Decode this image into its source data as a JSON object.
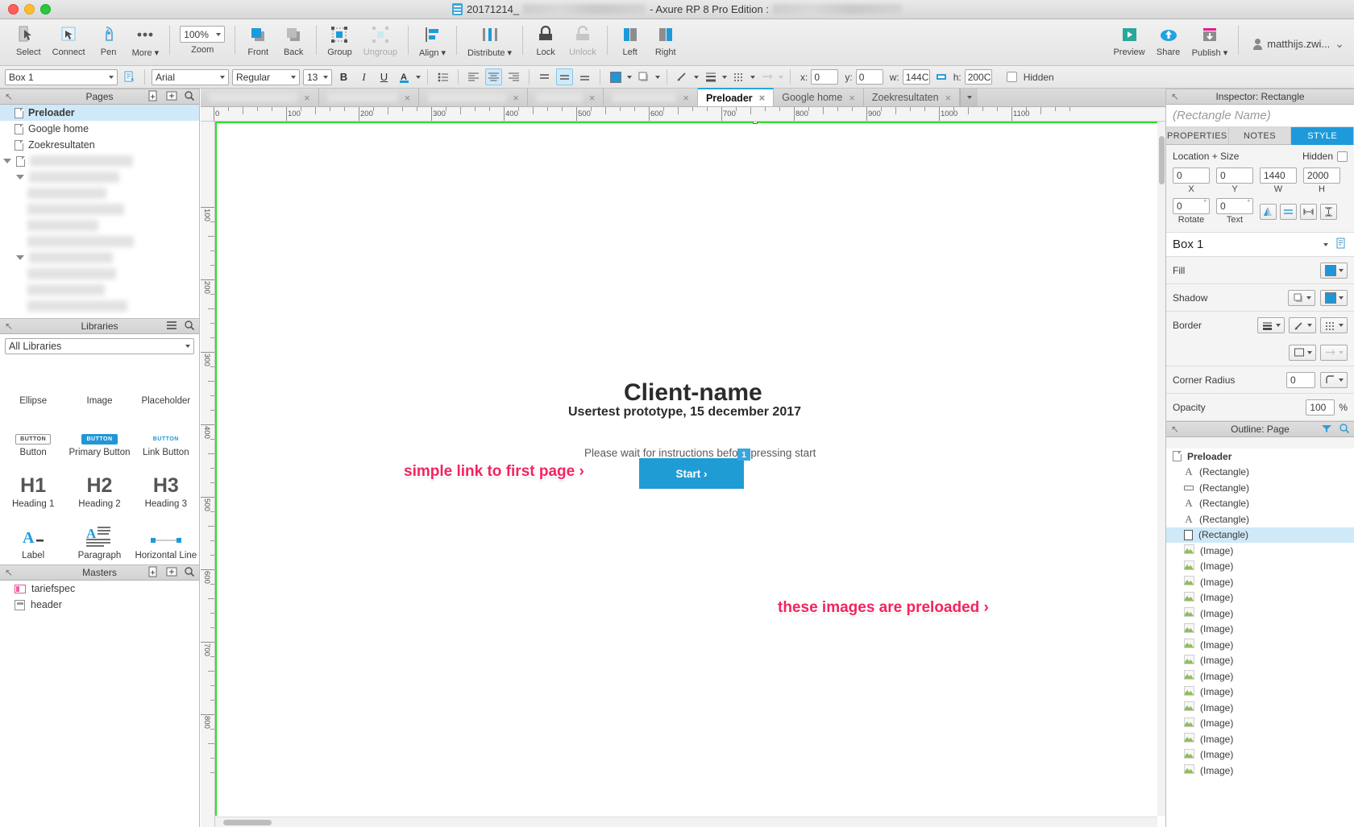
{
  "window": {
    "title_prefix": "20171214_",
    "title_mid": " - Axure RP 8 Pro Edition : ",
    "redacted": ""
  },
  "toolbar": {
    "items": [
      {
        "label": "Select",
        "name": "select-tool",
        "icon": "cursor-select-icon"
      },
      {
        "label": "Connect",
        "name": "connect-tool",
        "icon": "connect-icon"
      },
      {
        "label": "Pen",
        "name": "pen-tool",
        "icon": "pen-icon"
      },
      {
        "label": "More ▾",
        "name": "more-tool",
        "icon": "ellipsis-icon"
      }
    ],
    "zoom": {
      "value": "100%",
      "label": "Zoom"
    },
    "arrange": [
      {
        "label": "Front",
        "name": "bring-front-button"
      },
      {
        "label": "Back",
        "name": "send-back-button"
      },
      {
        "label": "Group",
        "name": "group-button"
      },
      {
        "label": "Ungroup",
        "name": "ungroup-button",
        "disabled": true
      }
    ],
    "align": {
      "label": "Align ▾"
    },
    "distribute": {
      "label": "Distribute ▾"
    },
    "lock": {
      "label": "Lock"
    },
    "unlock": {
      "label": "Unlock",
      "disabled": true
    },
    "left": {
      "label": "Left"
    },
    "right": {
      "label": "Right"
    },
    "preview": {
      "label": "Preview"
    },
    "share": {
      "label": "Share"
    },
    "publish": {
      "label": "Publish ▾"
    },
    "account": "matthijs.zwi..."
  },
  "formatbar": {
    "widget_name": "Box 1",
    "font_family": "Arial",
    "font_style": "Regular",
    "font_size": "13",
    "bold": "B",
    "italic": "I",
    "underline": "U",
    "font_color_glyph": "A",
    "x_label": "x:",
    "x_value": "0",
    "y_label": "y:",
    "y_value": "0",
    "w_label": "w:",
    "w_value": "144C",
    "h_label": "h:",
    "h_value": "200C",
    "hidden_label": "Hidden"
  },
  "pages": {
    "header": "Pages",
    "items": [
      {
        "label": "Preloader",
        "selected": true,
        "blurred": false
      },
      {
        "label": "Google home",
        "selected": false,
        "blurred": false
      },
      {
        "label": "Zoekresultaten",
        "selected": false,
        "blurred": false
      },
      {
        "label": "",
        "selected": false,
        "blurred": true
      },
      {
        "label": "",
        "selected": false,
        "blurred": true
      },
      {
        "label": "",
        "selected": false,
        "blurred": true
      },
      {
        "label": "",
        "selected": false,
        "blurred": true
      },
      {
        "label": "",
        "selected": false,
        "blurred": true
      },
      {
        "label": "",
        "selected": false,
        "blurred": true
      },
      {
        "label": "",
        "selected": false,
        "blurred": true
      },
      {
        "label": "",
        "selected": false,
        "blurred": true
      }
    ]
  },
  "libraries": {
    "header": "Libraries",
    "selected": "All Libraries",
    "widgets": [
      {
        "label": "Ellipse",
        "icon": "ellipse-widget-icon"
      },
      {
        "label": "Image",
        "icon": "image-widget-icon"
      },
      {
        "label": "Placeholder",
        "icon": "placeholder-widget-icon"
      },
      {
        "label": "Button",
        "icon": "button-widget-icon",
        "sample": "BUTTON"
      },
      {
        "label": "Primary Button",
        "icon": "primary-button-widget-icon",
        "sample": "BUTTON"
      },
      {
        "label": "Link Button",
        "icon": "link-button-widget-icon",
        "sample": "BUTTON"
      },
      {
        "label": "Heading 1",
        "icon": "heading1-widget-icon",
        "sample": "H1"
      },
      {
        "label": "Heading 2",
        "icon": "heading2-widget-icon",
        "sample": "H2"
      },
      {
        "label": "Heading 3",
        "icon": "heading3-widget-icon",
        "sample": "H3"
      },
      {
        "label": "Label",
        "icon": "label-widget-icon"
      },
      {
        "label": "Paragraph",
        "icon": "paragraph-widget-icon"
      },
      {
        "label": "Horizontal Line",
        "icon": "horizontal-line-widget-icon"
      }
    ]
  },
  "masters": {
    "header": "Masters",
    "items": [
      {
        "label": "tariefspec"
      },
      {
        "label": "header"
      }
    ]
  },
  "canvas": {
    "tabs": [
      {
        "label": "",
        "blurred": true,
        "active": false
      },
      {
        "label": "",
        "blurred": true,
        "active": false
      },
      {
        "label": "",
        "blurred": true,
        "active": false
      },
      {
        "label": "",
        "blurred": true,
        "active": false
      },
      {
        "label": "",
        "blurred": true,
        "active": false
      },
      {
        "label": "Preloader",
        "blurred": false,
        "active": true
      },
      {
        "label": "Google home",
        "blurred": false,
        "active": false
      },
      {
        "label": "Zoekresultaten",
        "blurred": false,
        "active": false
      }
    ],
    "ruler_h": [
      "0",
      "100",
      "200",
      "300",
      "400",
      "500",
      "600",
      "700",
      "800",
      "900",
      "1000",
      "1100"
    ],
    "ruler_v": [
      "100",
      "200",
      "300",
      "400",
      "500",
      "600",
      "700",
      "800"
    ],
    "content": {
      "client_title": "Client-name",
      "client_subtitle": "Usertest prototype, 15 december 2017",
      "wait_text": "Please wait for instructions before pressing start",
      "annotation_link": "simple link to first page ›",
      "start_button": "Start ›",
      "footnote_badge": "1",
      "annotation_images": "these images are preloaded ›"
    }
  },
  "inspector": {
    "header": "Inspector: Rectangle",
    "name_placeholder": "(Rectangle Name)",
    "tabs": [
      {
        "label": "PROPERTIES",
        "active": false
      },
      {
        "label": "NOTES",
        "active": false
      },
      {
        "label": "STYLE",
        "active": true
      }
    ],
    "location_size_label": "Location + Size",
    "hidden_label": "Hidden",
    "x": {
      "value": "0",
      "caption": "X"
    },
    "y": {
      "value": "0",
      "caption": "Y"
    },
    "w": {
      "value": "1440",
      "caption": "W"
    },
    "h": {
      "value": "2000",
      "caption": "H"
    },
    "rotate": {
      "value": "0",
      "caption": "Rotate"
    },
    "text_rotate": {
      "value": "0",
      "caption": "Text"
    },
    "style_name": "Box 1",
    "rows": [
      {
        "label": "Fill",
        "name": "fill-row"
      },
      {
        "label": "Shadow",
        "name": "shadow-row"
      },
      {
        "label": "Border",
        "name": "border-row"
      }
    ],
    "corner_radius": {
      "label": "Corner Radius",
      "value": "0"
    },
    "opacity": {
      "label": "Opacity",
      "value": "100",
      "unit": "%"
    }
  },
  "outline": {
    "header": "Outline: Page",
    "root": "Preloader",
    "items": [
      {
        "label": "(Rectangle)",
        "icon": "text-icon",
        "selected": false
      },
      {
        "label": "(Rectangle)",
        "icon": "line-icon",
        "selected": false
      },
      {
        "label": "(Rectangle)",
        "icon": "text-icon",
        "selected": false
      },
      {
        "label": "(Rectangle)",
        "icon": "text-icon",
        "selected": false
      },
      {
        "label": "(Rectangle)",
        "icon": "rect-icon",
        "selected": true
      },
      {
        "label": "(Image)",
        "icon": "image-icon",
        "selected": false
      },
      {
        "label": "(Image)",
        "icon": "image-icon",
        "selected": false
      },
      {
        "label": "(Image)",
        "icon": "image-icon",
        "selected": false
      },
      {
        "label": "(Image)",
        "icon": "image-icon",
        "selected": false
      },
      {
        "label": "(Image)",
        "icon": "image-icon",
        "selected": false
      },
      {
        "label": "(Image)",
        "icon": "image-icon",
        "selected": false
      },
      {
        "label": "(Image)",
        "icon": "image-icon",
        "selected": false
      },
      {
        "label": "(Image)",
        "icon": "image-icon",
        "selected": false
      },
      {
        "label": "(Image)",
        "icon": "image-icon",
        "selected": false
      },
      {
        "label": "(Image)",
        "icon": "image-icon",
        "selected": false
      },
      {
        "label": "(Image)",
        "icon": "image-icon",
        "selected": false
      },
      {
        "label": "(Image)",
        "icon": "image-icon",
        "selected": false
      },
      {
        "label": "(Image)",
        "icon": "image-icon",
        "selected": false
      },
      {
        "label": "(Image)",
        "icon": "image-icon",
        "selected": false
      },
      {
        "label": "(Image)",
        "icon": "image-icon",
        "selected": false
      }
    ]
  },
  "colors": {
    "accent": "#1e9ada",
    "pink": "#f2245f",
    "selection": "#cfe9f8",
    "start_button": "#1f9cd4"
  }
}
